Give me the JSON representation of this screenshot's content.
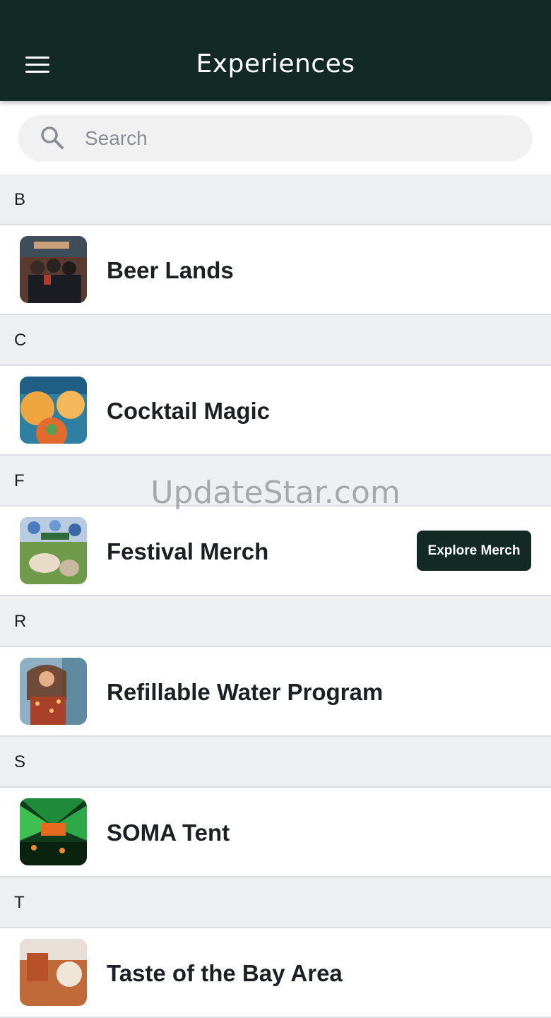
{
  "header": {
    "title": "Experiences",
    "menu_icon": "hamburger-menu-icon"
  },
  "search": {
    "placeholder": "Search",
    "value": "",
    "icon": "search-icon"
  },
  "sections": [
    {
      "letter": "B",
      "items": [
        {
          "label": "Beer Lands"
        }
      ]
    },
    {
      "letter": "C",
      "items": [
        {
          "label": "Cocktail Magic"
        }
      ]
    },
    {
      "letter": "F",
      "items": [
        {
          "label": "Festival Merch",
          "action": "Explore Merch"
        }
      ]
    },
    {
      "letter": "R",
      "items": [
        {
          "label": "Refillable Water Program"
        }
      ]
    },
    {
      "letter": "S",
      "items": [
        {
          "label": "SOMA Tent"
        }
      ]
    },
    {
      "letter": "T",
      "items": [
        {
          "label": "Taste of the Bay Area"
        }
      ]
    }
  ],
  "watermark": "UpdateStar.com",
  "colors": {
    "appbar": "#132a24",
    "section_bg": "#eeeff1",
    "button_bg": "#132a24"
  }
}
